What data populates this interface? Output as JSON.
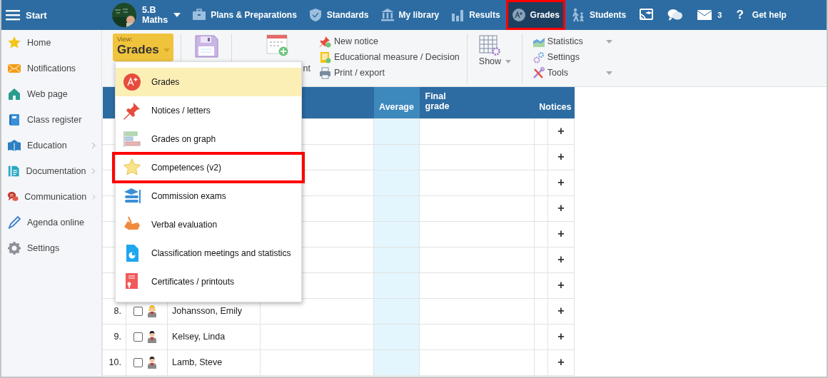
{
  "topbar": {
    "menu_label": "Start",
    "class": {
      "name": "5.B",
      "subject": "Maths"
    },
    "nav": [
      {
        "label": "Plans & Preparations",
        "selected": false,
        "annotated": false
      },
      {
        "label": "Standards",
        "selected": false,
        "annotated": false
      },
      {
        "label": "My library",
        "selected": false,
        "annotated": false
      },
      {
        "label": "Results",
        "selected": false,
        "annotated": false
      },
      {
        "label": "Grades",
        "selected": true,
        "annotated": true
      },
      {
        "label": "Students",
        "selected": false,
        "annotated": false
      }
    ],
    "messages": {
      "count": "3"
    },
    "help": {
      "glyph": "?",
      "label": "Get help"
    }
  },
  "sidebar": {
    "items": [
      {
        "label": "Home",
        "expandable": false
      },
      {
        "label": "Notifications",
        "expandable": false
      },
      {
        "label": "Web page",
        "expandable": false
      },
      {
        "label": "Class register",
        "expandable": false
      },
      {
        "label": "Education",
        "expandable": true
      },
      {
        "label": "Documentation",
        "expandable": true
      },
      {
        "label": "Communication",
        "expandable": true
      },
      {
        "label": "Agenda online",
        "expandable": false
      },
      {
        "label": "Settings",
        "expandable": false
      }
    ]
  },
  "toolbar": {
    "view": {
      "caption": "View:",
      "value": "Grades"
    },
    "new_label_fragment": "nt",
    "actions": [
      "New notice",
      "Educational measure / Decision",
      "Print / export"
    ],
    "show": "Show",
    "tools": [
      {
        "label": "Statistics",
        "dropdown": true
      },
      {
        "label": "Settings",
        "dropdown": false
      },
      {
        "label": "Tools",
        "dropdown": true
      }
    ]
  },
  "view_menu": {
    "items": [
      {
        "label": "Grades",
        "selected": true,
        "annotated": false
      },
      {
        "label": "Notices / letters",
        "selected": false,
        "annotated": false
      },
      {
        "label": "Grades on graph",
        "selected": false,
        "annotated": false
      },
      {
        "label": "Competences (v2)",
        "selected": false,
        "annotated": true
      },
      {
        "label": "Commission exams",
        "selected": false,
        "annotated": false
      },
      {
        "label": "Verbal evaluation",
        "selected": false,
        "annotated": false
      },
      {
        "label": "Classification meetings and statistics",
        "selected": false,
        "annotated": false
      },
      {
        "label": "Certificates / printouts",
        "selected": false,
        "annotated": false
      }
    ]
  },
  "table": {
    "columns": [
      "Average",
      "Final grade",
      "Notices"
    ],
    "rows": [
      {
        "add": "+"
      },
      {
        "add": "+"
      },
      {
        "add": "+"
      },
      {
        "add": "+"
      },
      {
        "add": "+"
      },
      {
        "add": "+"
      },
      {
        "add": "+"
      },
      {
        "number": "8.",
        "checked": false,
        "kind": "female",
        "name": "Johansson, Emily",
        "add": "+"
      },
      {
        "number": "9.",
        "checked": false,
        "kind": "male",
        "name": "Kelsey, Linda",
        "add": "+"
      },
      {
        "number": "10.",
        "checked": false,
        "kind": "male",
        "name": "Lamb, Steve",
        "add": "+"
      }
    ]
  }
}
